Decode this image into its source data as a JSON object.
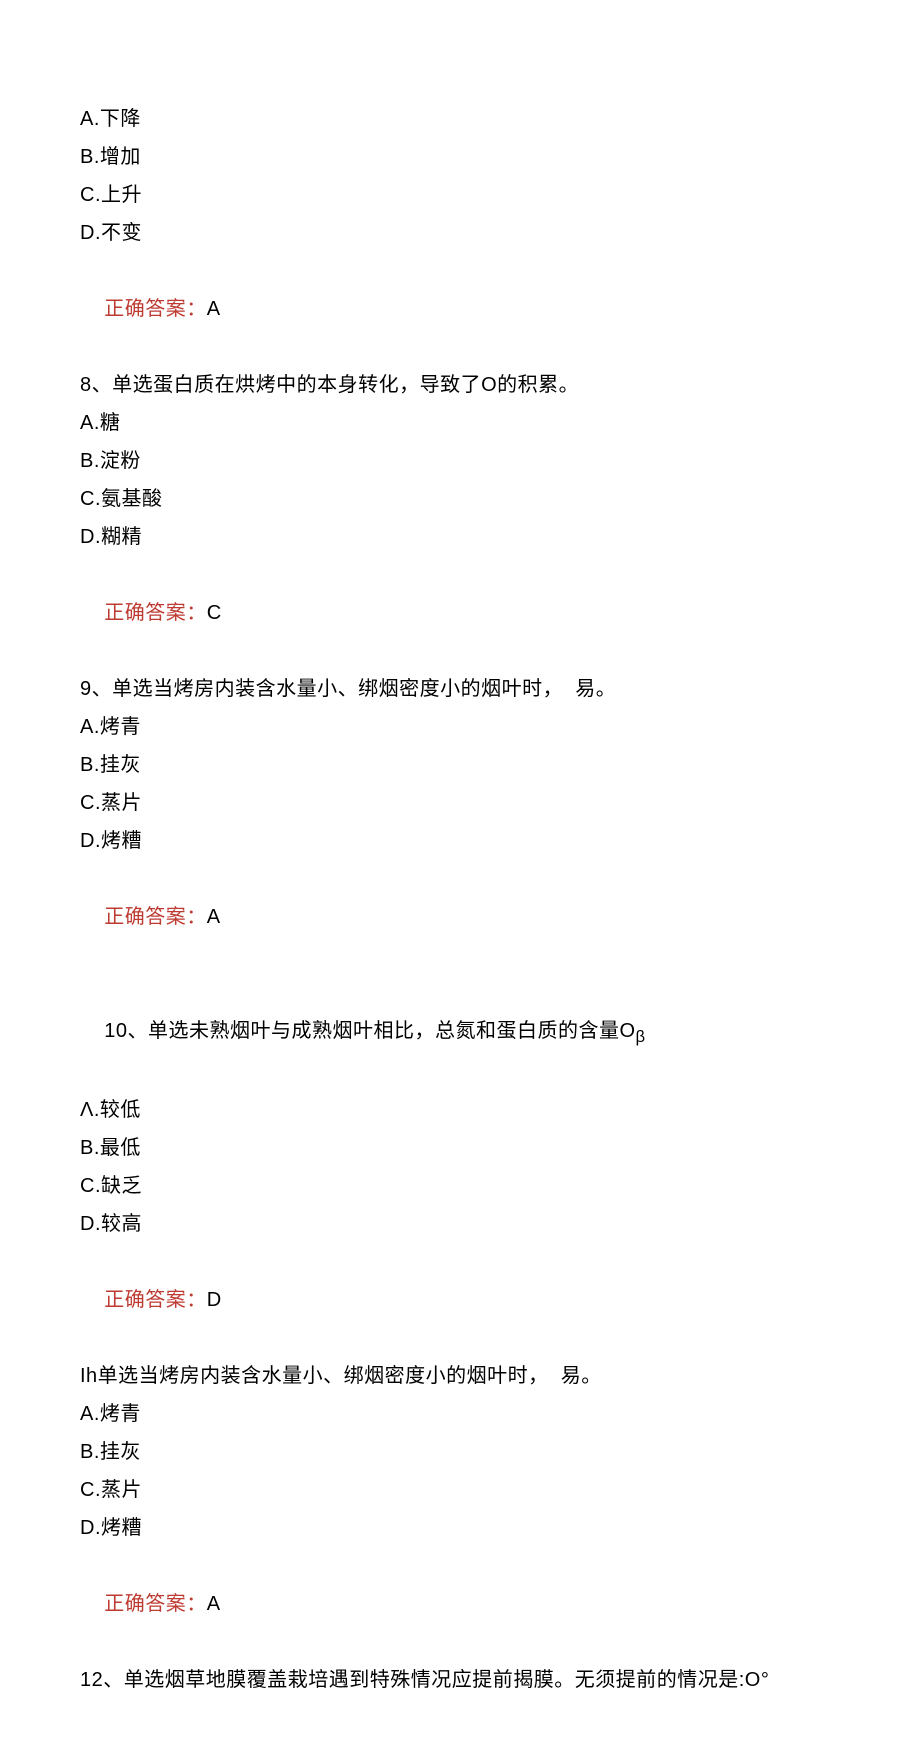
{
  "q7": {
    "optA": "A.下降",
    "optB": "B.增加",
    "optC": "C.上升",
    "optD": "D.不变",
    "answer_label": "正确答案：",
    "answer_value": "A"
  },
  "q8": {
    "stem": "8、单选蛋白质在烘烤中的本身转化，导致了O的积累。",
    "optA": "A.糖",
    "optB": "B.淀粉",
    "optC": "C.氨基酸",
    "optD": "D.糊精",
    "answer_label": "正确答案：",
    "answer_value": "C"
  },
  "q9": {
    "stem": "9、单选当烤房内装含水量小、绑烟密度小的烟叶时，  易。",
    "optA": "A.烤青",
    "optB": "B.挂灰",
    "optC": "C.蒸片",
    "optD": "D.烤糟",
    "answer_label": "正确答案：",
    "answer_value": "A"
  },
  "q10": {
    "stem_a": "10、单选未熟烟叶与成熟烟叶相比，总氮和蛋白质的含量O",
    "stem_b": "β",
    "optA": "Λ.较低",
    "optB": "B.最低",
    "optC": "C.缺乏",
    "optD": "D.较高",
    "answer_label": "正确答案：",
    "answer_value": "D"
  },
  "q11": {
    "stem": "Ih单选当烤房内装含水量小、绑烟密度小的烟叶时，  易。",
    "optA": "A.烤青",
    "optB": "B.挂灰",
    "optC": "C.蒸片",
    "optD": "D.烤糟",
    "answer_label": "正确答案：",
    "answer_value": "A"
  },
  "q12": {
    "stem": "12、单选烟草地膜覆盖栽培遇到特殊情况应提前揭膜。无须提前的情况是:O°"
  }
}
